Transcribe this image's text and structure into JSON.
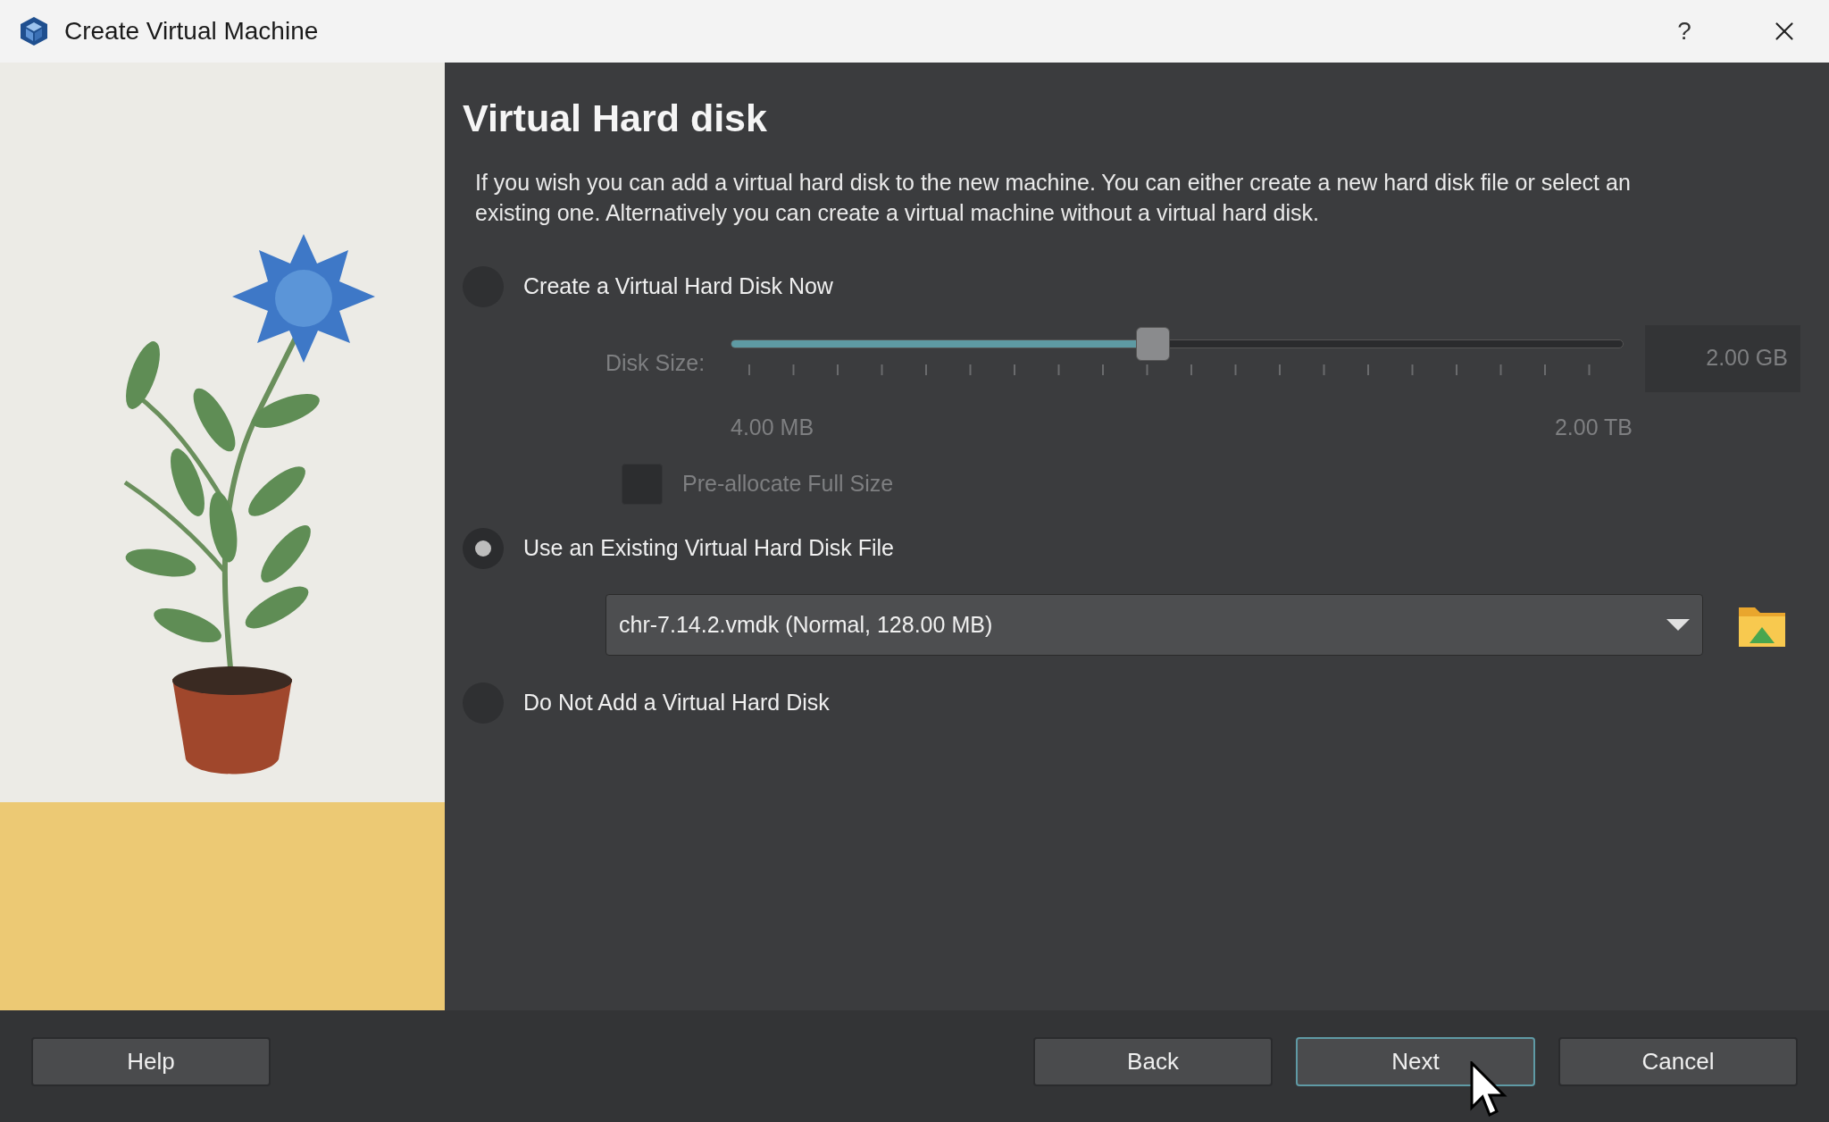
{
  "window": {
    "title": "Create Virtual Machine",
    "help_button": "?"
  },
  "page": {
    "heading": "Virtual Hard disk",
    "description": "If you wish you can add a virtual hard disk to the new machine. You can either create a new hard disk file or select an existing one. Alternatively you can create a virtual machine without a virtual hard disk."
  },
  "create_new": {
    "label": "Create a Virtual Hard Disk Now",
    "selected": false,
    "disk_size": {
      "label": "Disk Size:",
      "level": 0.473,
      "value": "2.00 GB",
      "min_label": "4.00 MB",
      "max_label": "2.00 TB",
      "disabled": true
    },
    "preallocate": {
      "label": "Pre-allocate Full Size",
      "checked": false,
      "disabled": true
    }
  },
  "use_existing": {
    "label": "Use an Existing Virtual Hard Disk File",
    "selected": true,
    "file": "chr-7.14.2.vmdk (Normal, 128.00 MB)"
  },
  "no_disk": {
    "label": "Do Not Add a Virtual Hard Disk",
    "selected": false
  },
  "buttons": [
    {
      "label": "Help",
      "default": false
    },
    {
      "label": "Back",
      "default": false
    },
    {
      "label": "Next",
      "default": true
    },
    {
      "label": "Cancel",
      "default": false
    }
  ]
}
